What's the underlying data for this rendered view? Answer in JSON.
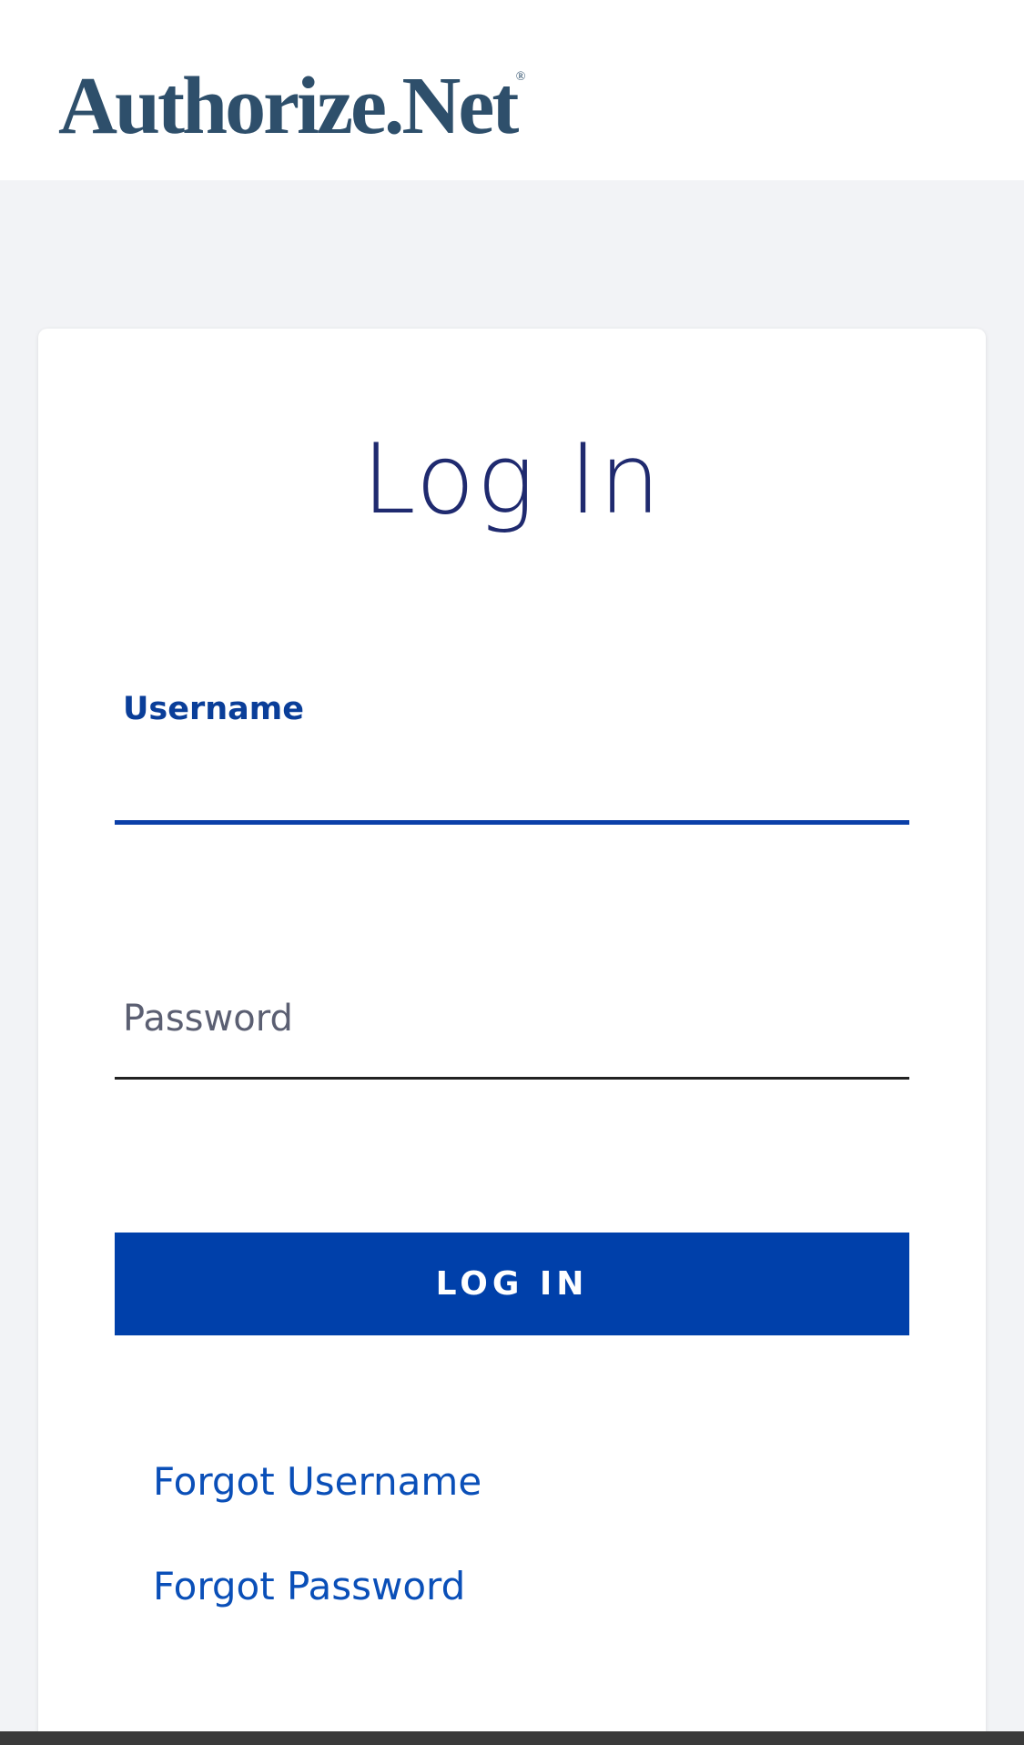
{
  "header": {
    "logo_text": "Authorize.Net",
    "logo_mark": "®"
  },
  "login": {
    "title": "Log In",
    "username": {
      "label": "Username",
      "value": ""
    },
    "password": {
      "placeholder": "Password",
      "value": ""
    },
    "submit_label": "LOG IN",
    "forgot_username_label": "Forgot Username",
    "forgot_password_label": "Forgot Password"
  },
  "colors": {
    "brand_blue": "#0040aa",
    "title_navy": "#1f2a6f",
    "link_blue": "#0a4fb8",
    "logo_slate": "#2e4f6b",
    "page_background": "#f2f3f6"
  }
}
